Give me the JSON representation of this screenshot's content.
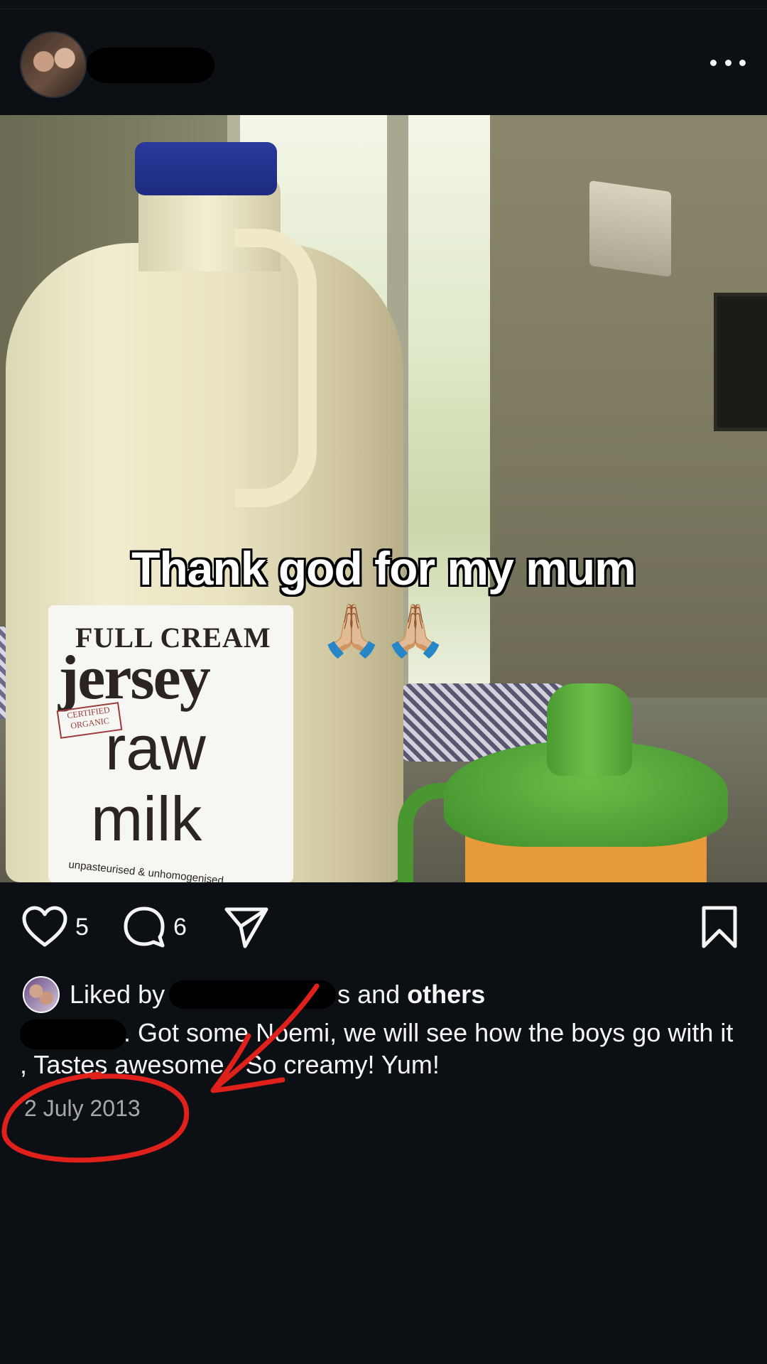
{
  "post": {
    "more_label": "•••",
    "overlay_text": "Thank god for my mum",
    "overlay_emoji": "🙏🏼🙏🏼",
    "photo_label": {
      "line1": "FULL CREAM",
      "line2": "jersey",
      "stamp": "CERTIFIED ORGANIC",
      "line3": "raw",
      "line4": "milk",
      "line5": "unpasteurised & unhomogenised"
    }
  },
  "actions": {
    "like_count": "5",
    "comment_count": "6"
  },
  "likes": {
    "prefix": "Liked by",
    "suffix": "s and",
    "others": "others"
  },
  "caption": {
    "text": ". Got some Noemi, we will see how the boys go with it , Tastes awesome.. So creamy! Yum!"
  },
  "date": "2 July 2013",
  "colors": {
    "background": "#0c1014",
    "text": "#f5f5f5",
    "date_text": "#a8a8a8",
    "annotation_red": "#e0201b"
  },
  "icons": [
    "more-icon",
    "heart-icon",
    "comment-icon",
    "share-icon",
    "bookmark-icon"
  ]
}
